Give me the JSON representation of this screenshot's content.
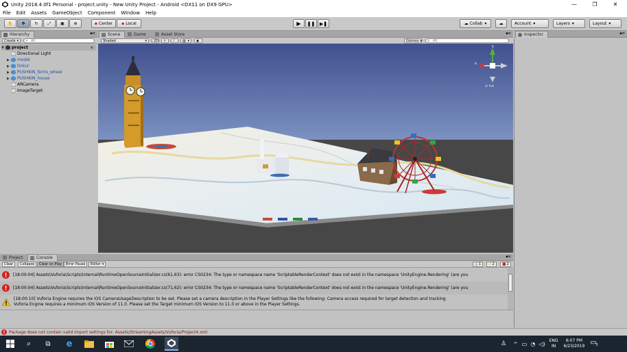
{
  "window": {
    "title": "Unity 2018.4.0f1 Personal - project.unity - New Unity Project - Android <DX11 on DX9 GPU>"
  },
  "menu": [
    "File",
    "Edit",
    "Assets",
    "GameObject",
    "Component",
    "Window",
    "Help"
  ],
  "toolbar": {
    "pivot_label": "Center",
    "space_label": "Local",
    "collab_label": "Collab",
    "account_label": "Account",
    "layers_label": "Layers",
    "layout_label": "Layout"
  },
  "hierarchy": {
    "tab": "Hierarchy",
    "create_label": "Create",
    "search_placeholder": "All",
    "scene_name": "project",
    "items": [
      {
        "label": "Directional Light",
        "expandable": false
      },
      {
        "label": "model",
        "expandable": true
      },
      {
        "label": "tinkur",
        "expandable": true
      },
      {
        "label": "PUSHKIN_ferris_wheel",
        "expandable": true
      },
      {
        "label": "PUSHKIN_house",
        "expandable": true
      },
      {
        "label": "ARCamera",
        "expandable": false
      },
      {
        "label": "ImageTarget",
        "expandable": false
      }
    ]
  },
  "scene": {
    "tabs": [
      "Scene",
      "Game",
      "Asset Store"
    ],
    "shading": "Shaded",
    "mode_2d": "2D",
    "gizmos_label": "Gizmos",
    "search_placeholder": "All",
    "persp_label": "≡ Iso"
  },
  "inspector": {
    "tab": "Inspector"
  },
  "console": {
    "tabs": [
      "Project",
      "Console"
    ],
    "buttons": [
      "Clear",
      "Collapse",
      "Clear on Play",
      "Error Pause",
      "Editor"
    ],
    "counts": {
      "info": "1",
      "warn": "2",
      "error": "2"
    },
    "rows": [
      {
        "type": "error",
        "line1": "[18:00:04] Assets\\Vuforia\\Scripts\\Internal\\RuntimeOpenSourceInitializer.cs(61,63): error CS0234: The type or namespace name 'ScriptableRenderContext' does not exist in the namespace 'UnityEngine.Rendering' (are you",
        "line2": ""
      },
      {
        "type": "error",
        "line1": "[18:00:04] Assets\\Vuforia\\Scripts\\Internal\\RuntimeOpenSourceInitializer.cs(71,62): error CS0234: The type or namespace name 'ScriptableRenderContext' does not exist in the namespace 'UnityEngine.Rendering' (are you",
        "line2": ""
      },
      {
        "type": "warning",
        "line1": "[18:00:10] Vuforia Engine requires the iOS CameraUsageDescription to be set. Please set a camera description in the Player Settings like the following: Camera access required for target detection and tracking",
        "line2": "Vuforia Engine requires a minimum iOS Version of 11.0. Please set the Target minimum iOS Version to 11.0 or above in the Player Settings."
      }
    ]
  },
  "status": {
    "message": "Package does not contain valid import settings for: Assets/StreamingAssets/Vuforia/Project4.xml"
  },
  "tray": {
    "lang1": "ENG",
    "lang2": "IN",
    "time": "6:07 PM",
    "date": "6/23/2019",
    "notif": "3"
  },
  "colors": {
    "sky_top": "#40508e",
    "sky_bottom": "#a2b8d9",
    "ground": "#474747",
    "error_red": "#d42020",
    "warn_yellow": "#f1c40f",
    "taskbar": "#1b2530"
  }
}
